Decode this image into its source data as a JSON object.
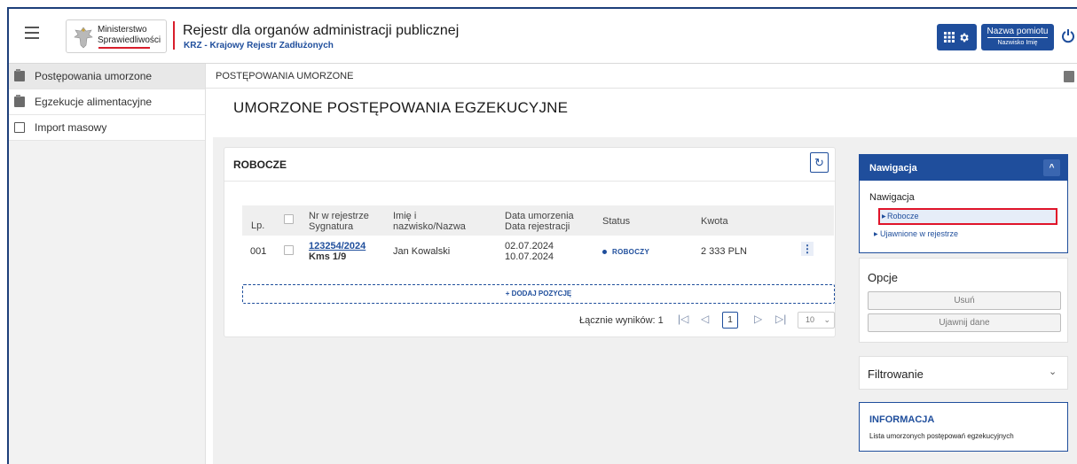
{
  "header": {
    "logo_line1": "Ministerstwo",
    "logo_line2": "Sprawiedliwości",
    "app_title": "Rejestr dla organów administracji publicznej",
    "app_subtitle": "KRZ - Krajowy Rejestr Zadłużonych",
    "user_name": "Nazwa pomiotu",
    "user_sub": "Nazwisko Imię",
    "icons": [
      "menu-icon",
      "apps-grid-icon",
      "gear-icon",
      "power-icon"
    ]
  },
  "sidebar": {
    "items": [
      {
        "label": "Postępowania umorzone",
        "icon": "folder-icon",
        "active": true
      },
      {
        "label": "Egzekucje alimentacyjne",
        "icon": "folder-icon",
        "active": false
      },
      {
        "label": "Import masowy",
        "icon": "import-icon",
        "active": false
      }
    ]
  },
  "breadcrumb": "POSTĘPOWANIA UMORZONE",
  "page_title": "UMORZONE POSTĘPOWANIA EGZEKUCYJNE",
  "card": {
    "title": "ROBOCZE",
    "refresh_icon": "↻",
    "columns": {
      "lp": "Lp.",
      "nr1": "Nr w rejestrze",
      "nr2": "Sygnatura",
      "name1": "Imię i",
      "name2": "nazwisko/Nazwa",
      "date1": "Data umorzenia",
      "date2": "Data rejestracji",
      "status": "Status",
      "amount": "Kwota"
    },
    "rows": [
      {
        "lp": "001",
        "nr": "123254/2024",
        "sygnatura": "Kms 1/9",
        "name": "Jan Kowalski",
        "date_umorzenia": "02.07.2024",
        "date_rejestracji": "10.07.2024",
        "status": "ROBOCZY",
        "amount": "2 333 PLN",
        "menu": "⋮"
      }
    ],
    "add_label": "+ DODAJ POZYCJĘ",
    "pager": {
      "total_label": "Łącznie wyników: 1",
      "first": "|◁",
      "prev": "◁",
      "page": "1",
      "next": "▷",
      "last": "▷|",
      "page_size": "10",
      "page_size_chevron": "⌄"
    }
  },
  "nav_panel": {
    "header": "Nawigacja",
    "collapse_icon": "^",
    "sub": "Nawigacja",
    "links": [
      "Robocze",
      "Ujawnione w rejestrze"
    ]
  },
  "options_panel": {
    "title": "Opcje",
    "buttons": [
      "Usuń",
      "Ujawnij dane"
    ]
  },
  "filter_panel": {
    "title": "Filtrowanie",
    "chevron": "⌄"
  },
  "info_panel": {
    "title": "INFORMACJA",
    "text": "Lista umorzonych postępowań egzekucyjnych"
  },
  "colors": {
    "primary": "#1f4e9c",
    "accent_red": "#d81e2c",
    "sidebar_bg": "#f2f2f2"
  }
}
